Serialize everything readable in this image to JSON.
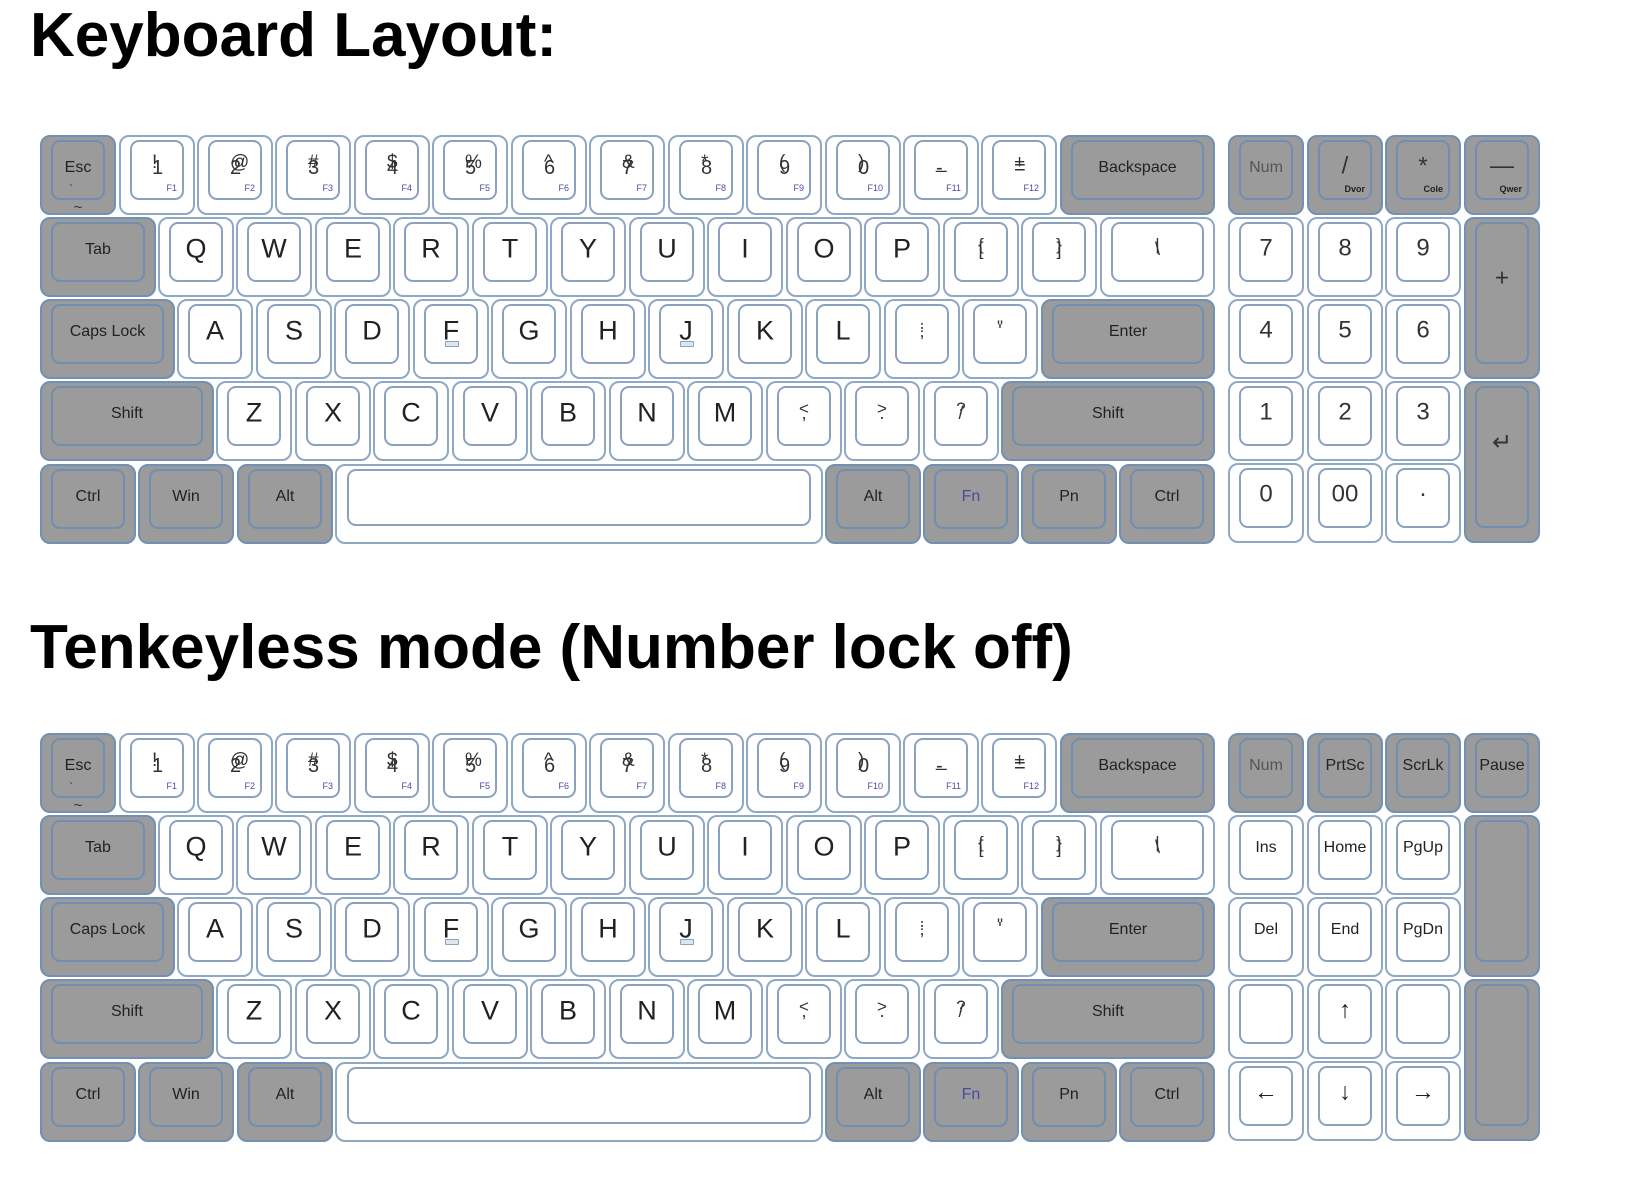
{
  "titles": {
    "main": "Keyboard Layout:",
    "tenkeyless": "Tenkeyless mode (Number lock off)"
  },
  "colors": {
    "key_white": "#ffffff",
    "key_gray": "#9b9b9b",
    "key_border": "#8fa8c4",
    "fn_label": "#4a4aa0"
  },
  "main_rows": {
    "number_row": [
      {
        "id": "esc",
        "label": "Esc",
        "style": "gray",
        "extra_top": "`",
        "extra_bottom": "~"
      },
      {
        "id": "1",
        "top": "!",
        "bottom": "1",
        "fn": "F1"
      },
      {
        "id": "2",
        "top": "@",
        "bottom": "2",
        "fn": "F2"
      },
      {
        "id": "3",
        "top": "#",
        "bottom": "3",
        "fn": "F3"
      },
      {
        "id": "4",
        "top": "$",
        "bottom": "4",
        "fn": "F4"
      },
      {
        "id": "5",
        "top": "%",
        "bottom": "5",
        "fn": "F5"
      },
      {
        "id": "6",
        "top": "^",
        "bottom": "6",
        "fn": "F6"
      },
      {
        "id": "7",
        "top": "&",
        "bottom": "7",
        "fn": "F7"
      },
      {
        "id": "8",
        "top": "*",
        "bottom": "8",
        "fn": "F8"
      },
      {
        "id": "9",
        "top": "(",
        "bottom": "9",
        "fn": "F9"
      },
      {
        "id": "0",
        "top": ")",
        "bottom": "0",
        "fn": "F10"
      },
      {
        "id": "minus",
        "top": "_",
        "bottom": "-",
        "fn": "F11"
      },
      {
        "id": "equals",
        "top": "+",
        "bottom": "=",
        "fn": "F12"
      },
      {
        "id": "backspace",
        "label": "Backspace",
        "style": "gray"
      }
    ],
    "tab_row": [
      {
        "id": "tab",
        "label": "Tab",
        "style": "gray"
      },
      {
        "id": "q",
        "label": "Q"
      },
      {
        "id": "w",
        "label": "W"
      },
      {
        "id": "e",
        "label": "E"
      },
      {
        "id": "r",
        "label": "R"
      },
      {
        "id": "t",
        "label": "T"
      },
      {
        "id": "y",
        "label": "Y"
      },
      {
        "id": "u",
        "label": "U"
      },
      {
        "id": "i",
        "label": "I"
      },
      {
        "id": "o",
        "label": "O"
      },
      {
        "id": "p",
        "label": "P"
      },
      {
        "id": "lbracket",
        "top": "{",
        "bottom": "["
      },
      {
        "id": "rbracket",
        "top": "}",
        "bottom": "]"
      },
      {
        "id": "backslash",
        "top": "|",
        "bottom": "\\"
      }
    ],
    "caps_row": [
      {
        "id": "capslock",
        "label": "Caps Lock",
        "style": "gray"
      },
      {
        "id": "a",
        "label": "A"
      },
      {
        "id": "s",
        "label": "S"
      },
      {
        "id": "d",
        "label": "D"
      },
      {
        "id": "f",
        "label": "F",
        "homing": true
      },
      {
        "id": "g",
        "label": "G"
      },
      {
        "id": "h",
        "label": "H"
      },
      {
        "id": "j",
        "label": "J",
        "homing": true
      },
      {
        "id": "k",
        "label": "K"
      },
      {
        "id": "l",
        "label": "L"
      },
      {
        "id": "semicolon",
        "top": ":",
        "bottom": ";"
      },
      {
        "id": "quote",
        "top": "\"",
        "bottom": "'"
      },
      {
        "id": "enter",
        "label": "Enter",
        "style": "gray"
      }
    ],
    "shift_row": [
      {
        "id": "lshift",
        "label": "Shift",
        "style": "gray"
      },
      {
        "id": "z",
        "label": "Z"
      },
      {
        "id": "x",
        "label": "X"
      },
      {
        "id": "c",
        "label": "C"
      },
      {
        "id": "v",
        "label": "V"
      },
      {
        "id": "b",
        "label": "B"
      },
      {
        "id": "n",
        "label": "N"
      },
      {
        "id": "m",
        "label": "M"
      },
      {
        "id": "comma",
        "top": "<",
        "bottom": ","
      },
      {
        "id": "period",
        "top": ">",
        "bottom": "."
      },
      {
        "id": "slash",
        "top": "?",
        "bottom": "/"
      },
      {
        "id": "rshift",
        "label": "Shift",
        "style": "gray"
      }
    ],
    "bottom_row": [
      {
        "id": "lctrl",
        "label": "Ctrl",
        "style": "gray"
      },
      {
        "id": "win",
        "label": "Win",
        "style": "gray"
      },
      {
        "id": "lalt",
        "label": "Alt",
        "style": "gray"
      },
      {
        "id": "space",
        "label": "",
        "style": "space"
      },
      {
        "id": "ralt",
        "label": "Alt",
        "style": "gray"
      },
      {
        "id": "fn",
        "label": "Fn",
        "style": "gray",
        "fn_color": true
      },
      {
        "id": "pn",
        "label": "Pn",
        "style": "gray"
      },
      {
        "id": "rctrl",
        "label": "Ctrl",
        "style": "gray"
      }
    ]
  },
  "numpad_on": {
    "row1": [
      {
        "id": "num",
        "label": "Num",
        "style": "gray",
        "dim": true
      },
      {
        "id": "divide",
        "label": "/",
        "style": "gray",
        "sub": "Dvor"
      },
      {
        "id": "multiply",
        "label": "*",
        "style": "gray",
        "sub": "Cole"
      },
      {
        "id": "subtract",
        "label": "—",
        "style": "gray",
        "sub": "Qwer"
      }
    ],
    "row2": [
      {
        "id": "n7",
        "label": "7"
      },
      {
        "id": "n8",
        "label": "8"
      },
      {
        "id": "n9",
        "label": "9"
      },
      {
        "id": "add",
        "label": "+",
        "style": "gray",
        "tall": true
      }
    ],
    "row3": [
      {
        "id": "n4",
        "label": "4"
      },
      {
        "id": "n5",
        "label": "5"
      },
      {
        "id": "n6",
        "label": "6"
      }
    ],
    "row4": [
      {
        "id": "n1",
        "label": "1"
      },
      {
        "id": "n2",
        "label": "2"
      },
      {
        "id": "n3",
        "label": "3"
      },
      {
        "id": "numenter",
        "label": "↵",
        "style": "gray",
        "tall": true
      }
    ],
    "row5": [
      {
        "id": "n0",
        "label": "0"
      },
      {
        "id": "n00",
        "label": "00"
      },
      {
        "id": "ndot",
        "label": "·"
      }
    ]
  },
  "numpad_off": {
    "row1": [
      {
        "id": "num",
        "label": "Num",
        "style": "gray",
        "dim": true
      },
      {
        "id": "prtsc",
        "label": "PrtSc",
        "style": "gray"
      },
      {
        "id": "scrlk",
        "label": "ScrLk",
        "style": "gray"
      },
      {
        "id": "pause",
        "label": "Pause",
        "style": "gray"
      }
    ],
    "row2": [
      {
        "id": "ins",
        "label": "Ins"
      },
      {
        "id": "home",
        "label": "Home"
      },
      {
        "id": "pgup",
        "label": "PgUp"
      },
      {
        "id": "blank_tall_1",
        "label": "",
        "style": "gray",
        "tall": true
      }
    ],
    "row3": [
      {
        "id": "del",
        "label": "Del"
      },
      {
        "id": "end",
        "label": "End"
      },
      {
        "id": "pgdn",
        "label": "PgDn"
      }
    ],
    "row4": [
      {
        "id": "blank_l",
        "label": ""
      },
      {
        "id": "up",
        "label": "↑",
        "arrow": true
      },
      {
        "id": "blank_r",
        "label": ""
      },
      {
        "id": "blank_tall_2",
        "label": "",
        "style": "gray",
        "tall": true
      }
    ],
    "row5": [
      {
        "id": "left",
        "label": "←",
        "arrow": true
      },
      {
        "id": "down",
        "label": "↓",
        "arrow": true
      },
      {
        "id": "right",
        "label": "→",
        "arrow": true
      }
    ]
  }
}
